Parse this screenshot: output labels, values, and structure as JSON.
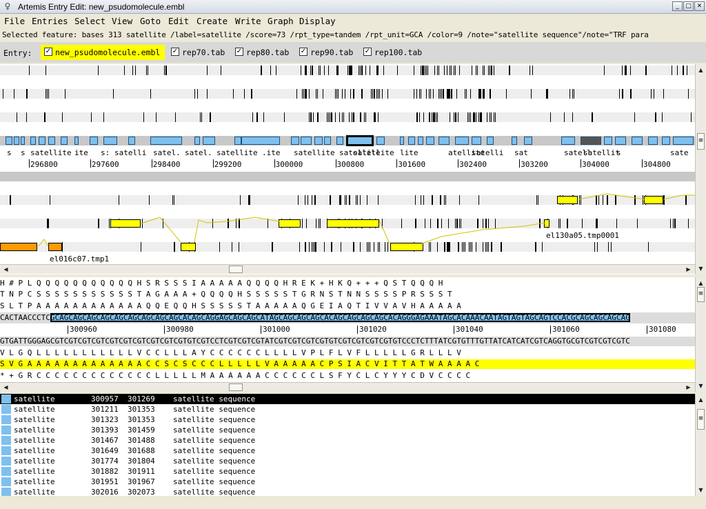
{
  "window": {
    "title": "Artemis Entry Edit: new_psudomolecule.embl",
    "minimize": "_",
    "maximize": "□",
    "close": "✕"
  },
  "menu": [
    "File",
    "Entries",
    "Select",
    "View",
    "Goto",
    "Edit",
    "Create",
    "Write",
    "Graph",
    "Display"
  ],
  "selected_feature": "Selected feature:  bases 313  satellite  /label=satellite /score=73 /rpt_type=tandem /rpt_unit=GCA /color=9 /note=\"satellite sequence\"/note=\"TRF para",
  "entry_bar": {
    "label": "Entry:",
    "entries": [
      {
        "name": "new_psudomolecule.embl",
        "checked": true,
        "active": true
      },
      {
        "name": "rep70.tab",
        "checked": true
      },
      {
        "name": "rep80.tab",
        "checked": true
      },
      {
        "name": "rep90.tab",
        "checked": true
      },
      {
        "name": "rep100.tab",
        "checked": true
      }
    ]
  },
  "overview": {
    "feature_labels": [
      "s",
      "s",
      "satellite",
      "ite",
      "s:",
      "satelli",
      "satel.",
      "satel.",
      "satellite",
      ".ite",
      "satellite",
      "satellite",
      "satellite",
      "lite",
      "atellite",
      "satelli",
      "sat",
      "satell",
      "satellit",
      "s",
      "sate"
    ],
    "ruler": [
      "296800",
      "297600",
      "298400",
      "299200",
      "300000",
      "300800",
      "301600",
      "302400",
      "303200",
      "304000",
      "304800"
    ],
    "blast_labels": [
      "el130a05.tmp0001",
      "el016c07.tmp1"
    ]
  },
  "base_view": {
    "aa_fwd": [
      "H # P L Q Q Q Q Q Q Q Q Q Q Q H S R S S S I A A A A A Q Q Q Q H R E K + H K Q + + + Q S T Q Q Q H",
      "T N P C S S S S S S S S S S S T A G A A A + Q Q Q Q H S S S S S T G R N S T N N S S S S P R S S S T",
      "S L T P A A A A A A A A A A A A Q Q E Q Q H S S S S S T A A A A A Q G E I A Q T I V V A V H A A A A A"
    ],
    "dna_fwd_prefix": "CACTAACCCTC",
    "dna_fwd_selected": "GCAGCAGCAGCAGCAGCAGCAGCAGCAGCACAGCAGGAGCAGCAGCATAGCAGCAGCAGCACAGCAGCAGCAGCACAGGGAGAAATAGCACAAACAATAGTAGTAGCAGTCCACGCAGCAGCAGCAG",
    "positions": [
      "300960",
      "300980",
      "301000",
      "301020",
      "301040",
      "301060",
      "301080"
    ],
    "dna_rev": "GTGATTGGGAGCGTCGTCGTCGTCGTCGTCGTCGTCGTCGTGTCGTCCTCGTCGTCGTATCGTCGTCGTCGTGTCGTCGTCGTCGTGTCCCTCTTTATCGTGTTTGTTATCATCATCGTCAGGTGCGTCGTCGTCGTC",
    "aa_rev": [
      "V L G Q L L L L L L L L L L L V C C L L L A Y C C C C C C L L L L V P L F L V F L L L L L G R L L L V",
      "S V G A A A A A A A A A A A A A C C S C S C C C L L L L L V A A A A A C P S I A C V I T T A T W A A A A C",
      "* + G R C C C C C C C C C C C C C L L L L L M A A A A A A C C C C C C L S F Y C L C Y Y Y C D V C C C C"
    ]
  },
  "feature_list": {
    "rows": [
      {
        "key": "satellite",
        "start": "300957",
        "end": "301269",
        "note": "satellite sequence",
        "selected": true
      },
      {
        "key": "satellite",
        "start": "301211",
        "end": "301353",
        "note": "satellite sequence"
      },
      {
        "key": "satellite",
        "start": "301323",
        "end": "301353",
        "note": "satellite sequence"
      },
      {
        "key": "satellite",
        "start": "301393",
        "end": "301459",
        "note": "satellite sequence"
      },
      {
        "key": "satellite",
        "start": "301467",
        "end": "301488",
        "note": "satellite sequence"
      },
      {
        "key": "satellite",
        "start": "301649",
        "end": "301688",
        "note": "satellite sequence"
      },
      {
        "key": "satellite",
        "start": "301774",
        "end": "301804",
        "note": "satellite sequence"
      },
      {
        "key": "satellite",
        "start": "301882",
        "end": "301911",
        "note": "satellite sequence"
      },
      {
        "key": "satellite",
        "start": "301951",
        "end": "301967",
        "note": "satellite sequence"
      },
      {
        "key": "satellite",
        "start": "302016",
        "end": "302073",
        "note": "satellite sequence"
      }
    ]
  },
  "colors": {
    "feature_fill": "#7ec0ee",
    "blast_hit": "#ffff00",
    "blast_hit_alt": "#ff9900",
    "entry_active": "#ffff00",
    "selection": "#000000"
  },
  "icons": {
    "scroll_up": "▲",
    "scroll_down": "▼",
    "scroll_left": "◀",
    "scroll_right": "▶",
    "grip": "≡",
    "checkmark": "✓",
    "app": "♀"
  }
}
